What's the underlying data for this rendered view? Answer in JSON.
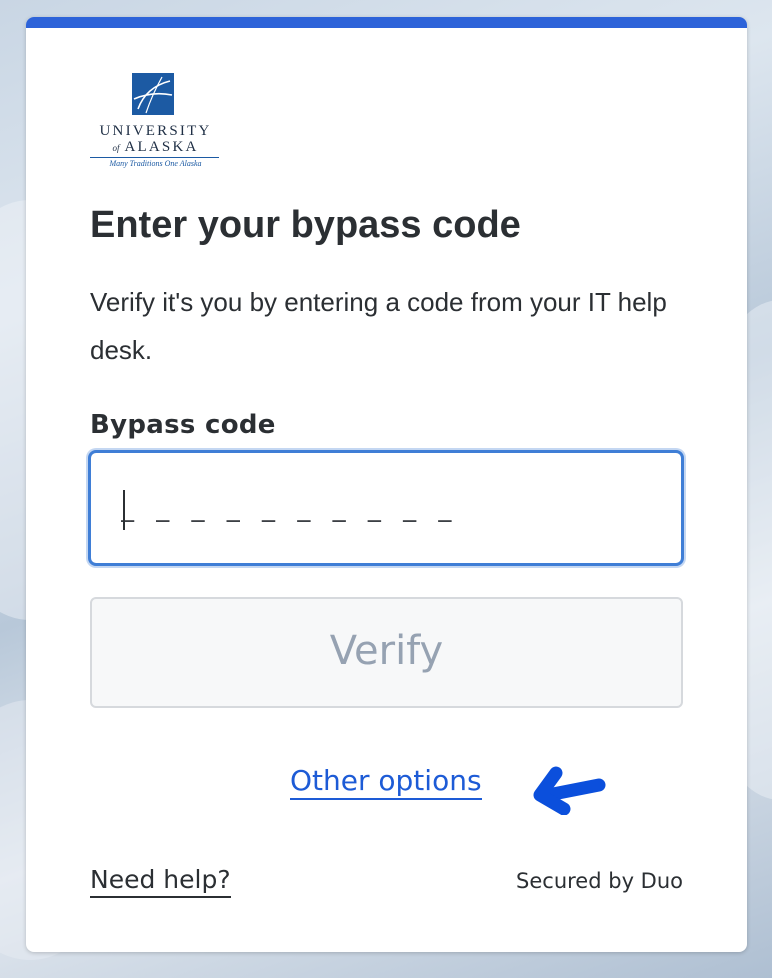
{
  "logo": {
    "line1": "UNIVERSITY",
    "of": "of",
    "line2": "ALASKA",
    "tagline": "Many Traditions One Alaska"
  },
  "heading": "Enter your bypass code",
  "description": "Verify it's you by entering a code from your IT help desk.",
  "bypass": {
    "label": "Bypass code",
    "placeholder": "_ _ _ _ _ _ _ _ _ _",
    "value": ""
  },
  "verify_label": "Verify",
  "other_options_label": "Other options",
  "need_help_label": "Need help?",
  "secured_by": "Secured by Duo",
  "colors": {
    "accent": "#2d63d9",
    "link": "#1d5bd6",
    "input_focus": "#3f7ed6",
    "annotation_arrow": "#0b4fdc"
  },
  "icons": {
    "logo_mark": "university-logo-icon",
    "annotation": "pointer-arrow-icon"
  }
}
